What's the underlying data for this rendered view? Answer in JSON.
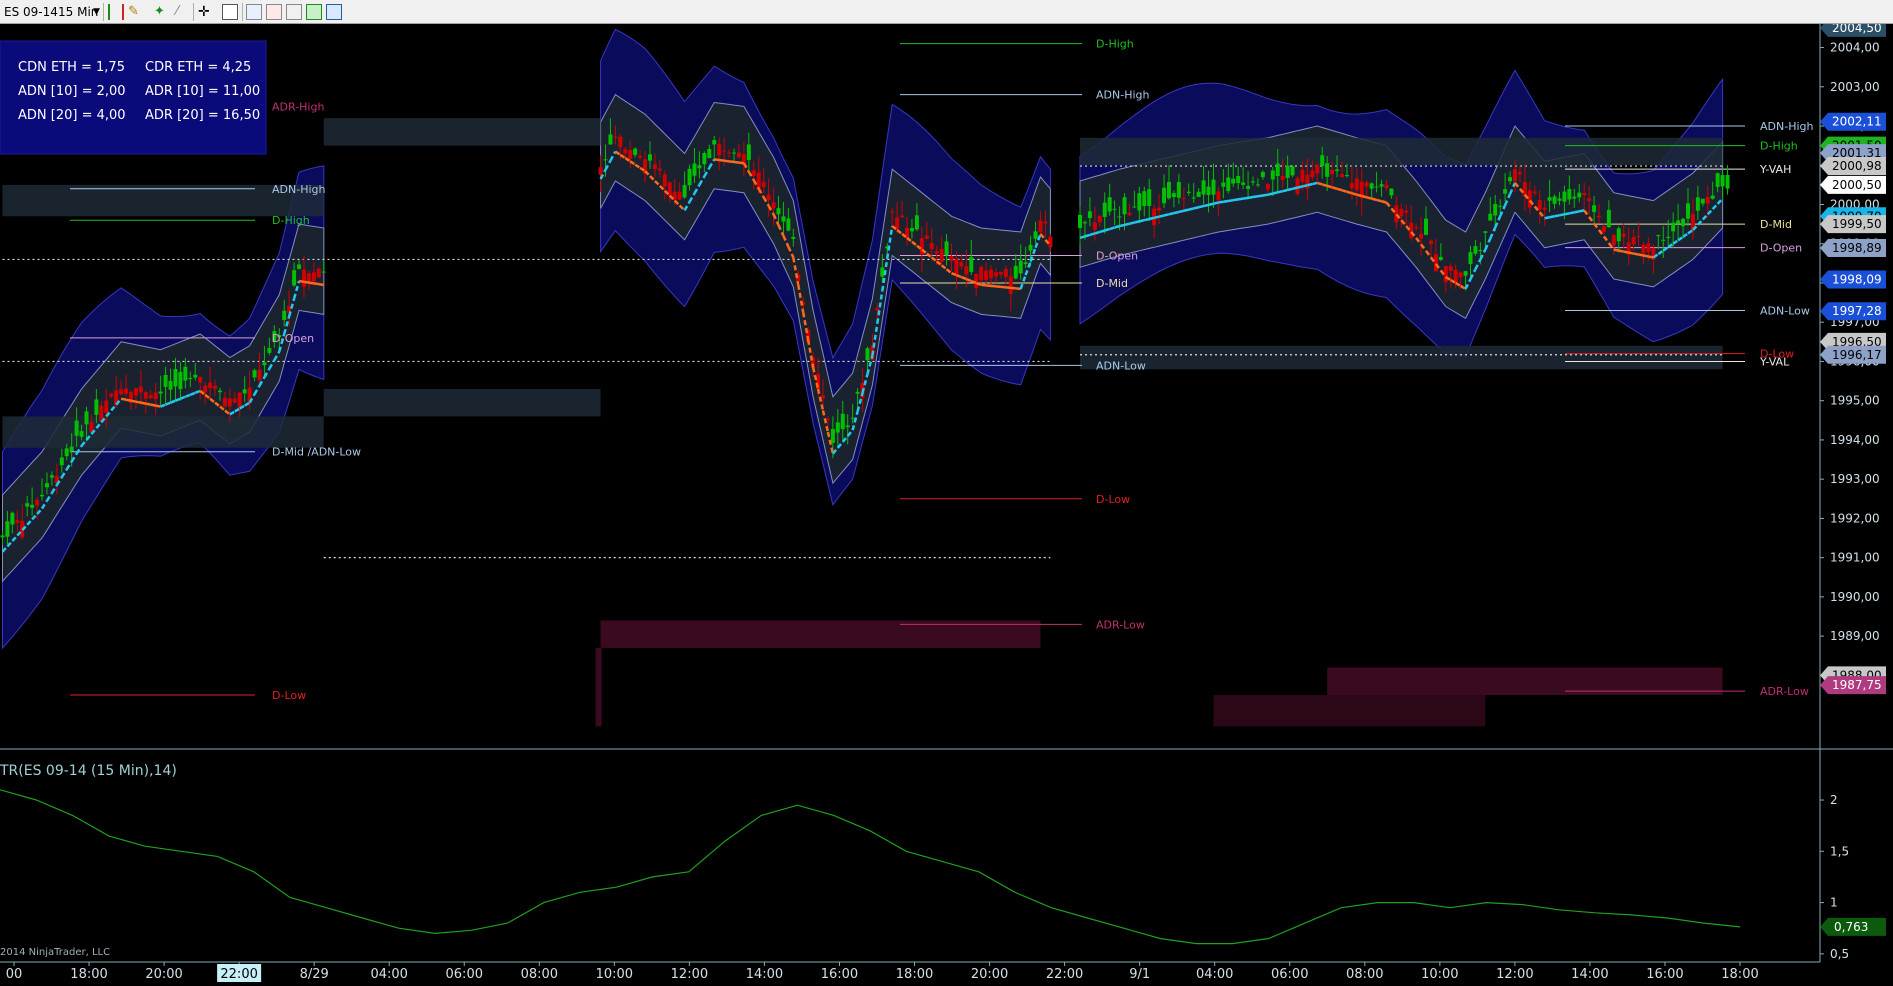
{
  "toolbar": {
    "instrument": "ES 09-14",
    "interval": "15 Min",
    "icons": [
      "bar-type-icon",
      "draw-tool-icon",
      "stars-icon",
      "zoom-icon",
      "crosshair-icon",
      "properties-icon",
      "data-box-icon",
      "trade-icon",
      "strategy-icon",
      "chart-trader-icon"
    ]
  },
  "info_box": {
    "rows": [
      [
        "CDN ETH = 1,75",
        "CDR ETH = 4,25"
      ],
      [
        "ADN [10] = 2,00",
        "ADR [10] = 11,00"
      ],
      [
        "ADN [20] = 4,00",
        "ADR [20] = 16,50"
      ]
    ]
  },
  "indicator_label": "TR(ES 09-14 (15 Min),14)",
  "copyright": "2014 NinjaTrader, LLC",
  "colors": {
    "background": "#000000",
    "up_candle": "#00c000",
    "down_candle": "#d00000",
    "band_fill": "#0c0c60",
    "zone_fill": "#1e2a36",
    "vwap_up": "#22c8ee",
    "vwap_down": "#ff6a1a",
    "atr_line": "#1fa01f"
  },
  "chart_data": [
    {
      "type": "candlestick",
      "title": "",
      "y_axis_ticks": [
        "2004,00",
        "2003,00",
        "2002,00",
        "2001,00",
        "2000,00",
        "1999,00",
        "1998,00",
        "1997,00",
        "1996,00",
        "1995,00",
        "1994,00",
        "1993,00",
        "1992,00",
        "1991,00",
        "1990,00",
        "1989,00",
        "1988,00"
      ],
      "ylim": [
        1986.2,
        2004.6
      ],
      "x_axis_ticks": [
        "00",
        "18:00",
        "20:00",
        "22:00",
        "8/29",
        "04:00",
        "06:00",
        "08:00",
        "10:00",
        "12:00",
        "14:00",
        "16:00",
        "18:00",
        "20:00",
        "22:00",
        "9/1",
        "04:00",
        "06:00",
        "08:00",
        "10:00",
        "12:00",
        "14:00",
        "16:00",
        "18:00"
      ],
      "highlighted_x_tick": "22:00",
      "price_tags": [
        {
          "value": "2004,50",
          "color": "#2a4f66",
          "text_color": "#ffffff"
        },
        {
          "value": "2002,11",
          "color": "#1a4fd8",
          "text_color": "#ffffff"
        },
        {
          "value": "2001,50",
          "color": "#1fb31f",
          "text_color": "#000000"
        },
        {
          "value": "2001,31",
          "color": "#8ea2c8",
          "text_color": "#000000"
        },
        {
          "value": "2000,98",
          "color": "#c8c8c8",
          "text_color": "#000000"
        },
        {
          "value": "2000,50",
          "color": "#ffffff",
          "text_color": "#000000"
        },
        {
          "value": "1999,70",
          "color": "#19b5e8",
          "text_color": "#000000"
        },
        {
          "value": "1999,50",
          "color": "#c8c8c8",
          "text_color": "#000000"
        },
        {
          "value": "1998,89",
          "color": "#8ea2c8",
          "text_color": "#000000"
        },
        {
          "value": "1998,09",
          "color": "#1a4fd8",
          "text_color": "#ffffff"
        },
        {
          "value": "1997,28",
          "color": "#1a4fd8",
          "text_color": "#ffffff"
        },
        {
          "value": "1996,50",
          "color": "#c8c8c8",
          "text_color": "#000000"
        },
        {
          "value": "1996,17",
          "color": "#8ea2c8",
          "text_color": "#000000"
        },
        {
          "value": "1988,00",
          "color": "#c8c8c8",
          "text_color": "#000000"
        },
        {
          "value": "1987,75",
          "color": "#b03a80",
          "text_color": "#ffffff"
        }
      ],
      "annotations": [
        {
          "text": "ADR-High",
          "color": "#c03070",
          "session": 1
        },
        {
          "text": "ADN-High",
          "color": "#a8c8e8",
          "session": 1
        },
        {
          "text": "D-High",
          "color": "#20c020",
          "session": 1
        },
        {
          "text": "D-Open",
          "color": "#d8a0e0",
          "session": 1
        },
        {
          "text": "D-Mid /ADN-Low",
          "color": "#a8c8e8",
          "session": 1
        },
        {
          "text": "D-Low",
          "color": "#e02020",
          "session": 1
        },
        {
          "text": "D-High",
          "color": "#20c020",
          "session": 2
        },
        {
          "text": "ADN-High",
          "color": "#a8c8e8",
          "session": 2
        },
        {
          "text": "D-Open",
          "color": "#d8a0e0",
          "session": 2
        },
        {
          "text": "D-Mid",
          "color": "#e8e0a0",
          "session": 2
        },
        {
          "text": "ADN-Low",
          "color": "#a8c8e8",
          "session": 2
        },
        {
          "text": "D-Low",
          "color": "#e02020",
          "session": 2
        },
        {
          "text": "ADR-Low",
          "color": "#c03070",
          "session": 2
        },
        {
          "text": "ADN-High",
          "color": "#a8c8e8",
          "session": 3
        },
        {
          "text": "D-High",
          "color": "#20c020",
          "session": 3
        },
        {
          "text": "Y-VAH",
          "color": "#e8e8e8",
          "session": 3
        },
        {
          "text": "D-Mid",
          "color": "#e8e0a0",
          "session": 3
        },
        {
          "text": "D-Open",
          "color": "#d8a0e0",
          "session": 3
        },
        {
          "text": "D-Low",
          "color": "#e02020",
          "session": 3
        },
        {
          "text": "Y-VAL",
          "color": "#e8e8e8",
          "session": 3
        },
        {
          "text": "ADN-Low",
          "color": "#a8c8e8",
          "session": 3
        },
        {
          "text": "ADR-Low",
          "color": "#c03070",
          "session": 3
        }
      ],
      "anchor_points": [
        {
          "x": 0,
          "y": 1991.5
        },
        {
          "x": 8,
          "y": 1992.6
        },
        {
          "x": 16,
          "y": 1994.2
        },
        {
          "x": 24,
          "y": 1995.4
        },
        {
          "x": 32,
          "y": 1995.2
        },
        {
          "x": 40,
          "y": 1995.6
        },
        {
          "x": 46,
          "y": 1995.0
        },
        {
          "x": 50,
          "y": 1995.3
        },
        {
          "x": 56,
          "y": 1996.6
        },
        {
          "x": 60,
          "y": 1998.4
        },
        {
          "x": 65,
          "y": 1998.3
        },
        {
          "x": 72,
          "y": 1998.5
        },
        {
          "x": 80,
          "y": 1998.2
        },
        {
          "x": 88,
          "y": 1998.0
        },
        {
          "x": 96,
          "y": 1998.3
        },
        {
          "x": 104,
          "y": 1998.0
        },
        {
          "x": 112,
          "y": 1998.3
        },
        {
          "x": 118,
          "y": 1998.9
        },
        {
          "x": 121,
          "y": 2001.0
        },
        {
          "x": 124,
          "y": 2001.7
        },
        {
          "x": 130,
          "y": 2001.2
        },
        {
          "x": 138,
          "y": 2000.2
        },
        {
          "x": 144,
          "y": 2001.5
        },
        {
          "x": 150,
          "y": 2001.4
        },
        {
          "x": 156,
          "y": 2000.1
        },
        {
          "x": 160,
          "y": 1999.0
        },
        {
          "x": 164,
          "y": 1996.2
        },
        {
          "x": 168,
          "y": 1994.0
        },
        {
          "x": 172,
          "y": 1994.6
        },
        {
          "x": 176,
          "y": 1996.5
        },
        {
          "x": 180,
          "y": 1999.8
        },
        {
          "x": 186,
          "y": 1999.2
        },
        {
          "x": 192,
          "y": 1998.6
        },
        {
          "x": 198,
          "y": 1998.3
        },
        {
          "x": 206,
          "y": 1998.2
        },
        {
          "x": 210,
          "y": 1999.6
        },
        {
          "x": 214,
          "y": 1999.0
        },
        {
          "x": 218,
          "y": 1999.5
        },
        {
          "x": 226,
          "y": 1999.8
        },
        {
          "x": 236,
          "y": 2000.1
        },
        {
          "x": 246,
          "y": 2000.4
        },
        {
          "x": 256,
          "y": 2000.6
        },
        {
          "x": 266,
          "y": 2000.9
        },
        {
          "x": 274,
          "y": 2000.6
        },
        {
          "x": 280,
          "y": 2000.4
        },
        {
          "x": 286,
          "y": 1999.5
        },
        {
          "x": 292,
          "y": 1998.5
        },
        {
          "x": 296,
          "y": 1998.2
        },
        {
          "x": 300,
          "y": 1999.2
        },
        {
          "x": 306,
          "y": 2000.9
        },
        {
          "x": 312,
          "y": 2000.0
        },
        {
          "x": 320,
          "y": 2000.2
        },
        {
          "x": 326,
          "y": 1999.2
        },
        {
          "x": 334,
          "y": 1999.0
        },
        {
          "x": 342,
          "y": 1999.7
        },
        {
          "x": 348,
          "y": 2000.5
        }
      ]
    },
    {
      "type": "line",
      "title": "TR(ES 09-14 (15 Min),14)",
      "series": [
        {
          "values": [
            2.1,
            2.0,
            1.85,
            1.65,
            1.55,
            1.5,
            1.45,
            1.3,
            1.05,
            0.95,
            0.85,
            0.75,
            0.7,
            0.73,
            0.8,
            1.0,
            1.1,
            1.15,
            1.25,
            1.3,
            1.6,
            1.85,
            1.95,
            1.85,
            1.7,
            1.5,
            1.4,
            1.3,
            1.1,
            0.95,
            0.85,
            0.75,
            0.65,
            0.6,
            0.6,
            0.65,
            0.8,
            0.95,
            1.0,
            1.0,
            0.95,
            1.0,
            0.98,
            0.93,
            0.9,
            0.88,
            0.85,
            0.8,
            0.763
          ]
        }
      ],
      "y_axis_ticks": [
        "2",
        "1,5",
        "1",
        "0,5"
      ],
      "ylim": [
        0.45,
        2.4
      ],
      "last_value": "0,763"
    }
  ]
}
